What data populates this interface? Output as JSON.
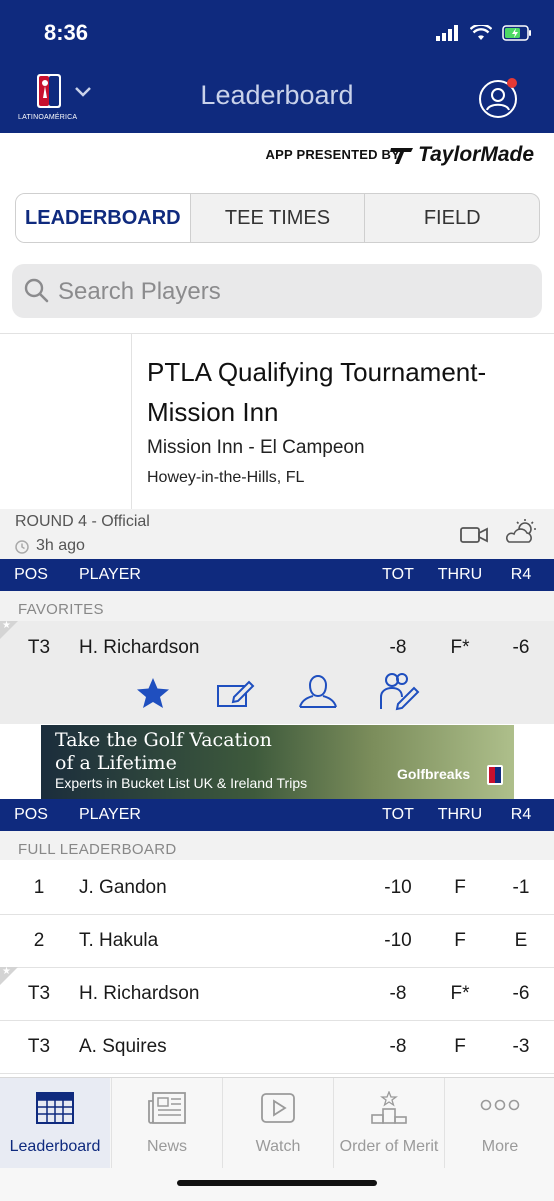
{
  "status_bar": {
    "time": "8:36"
  },
  "nav": {
    "title": "Leaderboard",
    "logo_caption": "LATINOAMÉRICA"
  },
  "sponsor": {
    "text": "APP PRESENTED BY",
    "brand": "TaylorMade"
  },
  "tabs": [
    {
      "label": "LEADERBOARD",
      "active": true
    },
    {
      "label": "TEE TIMES",
      "active": false
    },
    {
      "label": "FIELD",
      "active": false
    }
  ],
  "search": {
    "placeholder": "Search Players",
    "value": ""
  },
  "tournament": {
    "name": "PTLA Qualifying Tournament-Mission Inn",
    "course": "Mission Inn - El Campeon",
    "location": "Howey-in-the-Hills, FL",
    "round": "ROUND 4 - Official",
    "updated": "3h ago"
  },
  "columns": {
    "pos": "POS",
    "player": "PLAYER",
    "tot": "TOT",
    "thru": "THRU",
    "r4": "R4"
  },
  "favorites": {
    "label": "FAVORITES",
    "rows": [
      {
        "pos": "T3",
        "player": "H. Richardson",
        "tot": "-8",
        "thru": "F*",
        "r4": "-6"
      }
    ]
  },
  "ad": {
    "line1": "Take the Golf Vacation",
    "line2": "of a Lifetime",
    "line3": "Experts in Bucket List UK & Ireland Trips",
    "brand": "Golfbreaks"
  },
  "full_leaderboard": {
    "label": "FULL LEADERBOARD",
    "rows": [
      {
        "pos": "1",
        "player": "J. Gandon",
        "tot": "-10",
        "thru": "F",
        "r4": "-1",
        "favorite": false
      },
      {
        "pos": "2",
        "player": "T. Hakula",
        "tot": "-10",
        "thru": "F",
        "r4": "E",
        "favorite": false
      },
      {
        "pos": "T3",
        "player": "H. Richardson",
        "tot": "-8",
        "thru": "F*",
        "r4": "-6",
        "favorite": true
      },
      {
        "pos": "T3",
        "player": "A. Squires",
        "tot": "-8",
        "thru": "F",
        "r4": "-3",
        "favorite": false
      }
    ]
  },
  "bottom_tabs": [
    {
      "label": "Leaderboard",
      "icon": "leaderboard-icon",
      "active": true
    },
    {
      "label": "News",
      "icon": "news-icon",
      "active": false
    },
    {
      "label": "Watch",
      "icon": "play-icon",
      "active": false
    },
    {
      "label": "Order of Merit",
      "icon": "podium-icon",
      "active": false
    },
    {
      "label": "More",
      "icon": "more-dots-icon",
      "active": false
    }
  ],
  "colors": {
    "primary": "#0f2a7e",
    "accent": "#1f4fbf",
    "notification": "#e53935"
  }
}
